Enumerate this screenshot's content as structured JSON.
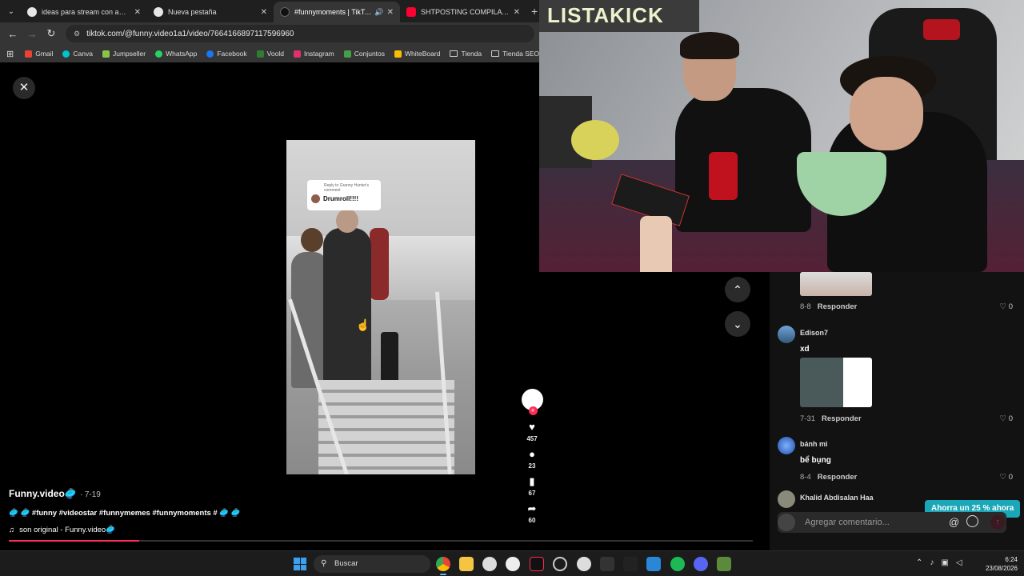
{
  "browser": {
    "tabs": [
      {
        "title": "ideas para stream con amigos",
        "fav_color": "#e6e6e6",
        "active": false
      },
      {
        "title": "Nueva pestaña",
        "fav_color": "#e6e6e6",
        "active": false
      },
      {
        "title": "#funnymoments | TikTok",
        "fav_color": "#111111",
        "active": true
      },
      {
        "title": "SHTPOSTING COMPILATION V",
        "fav_color": "#ff0033",
        "active": false
      }
    ],
    "url": "tiktok.com/@funny.video1a1/video/7664166897117596960",
    "bookmarks": [
      {
        "label": "Gmail",
        "color": "#ea4335"
      },
      {
        "label": "Canva",
        "color": "#00c4cc"
      },
      {
        "label": "Jumpseller",
        "color": "#8bc34a"
      },
      {
        "label": "WhatsApp",
        "color": "#25d366"
      },
      {
        "label": "Facebook",
        "color": "#1877f2"
      },
      {
        "label": "Voold",
        "color": "#2e7d32"
      },
      {
        "label": "Instagram",
        "color": "#e1306c"
      },
      {
        "label": "Conjuntos",
        "color": "#43a047"
      },
      {
        "label": "WhiteBoard",
        "color": "#fbbc05"
      },
      {
        "label": "Tienda",
        "folder": true
      },
      {
        "label": "Tienda SEO",
        "folder": true
      }
    ]
  },
  "video": {
    "reply_card_small": "Reply to Granny Hunter's comment",
    "reply_card_text": "Drumroll!!!!",
    "progress": 0.175
  },
  "caption": {
    "author": "Funny.video🥏",
    "date": "· 7-19",
    "description": "🥏 🥏 #funny #videostar #funnymemes #funnymoments # 🥏 🥏",
    "sound": "son original - Funny.video🥏"
  },
  "actions": {
    "likes": "457",
    "comments": "23",
    "saves": "67",
    "shares": "60"
  },
  "comments": [
    {
      "name": "",
      "text": "",
      "date": "8-8",
      "reply": "Responder",
      "likes": "0"
    },
    {
      "name": "Edison7",
      "text": "xd",
      "date": "7-31",
      "reply": "Responder",
      "likes": "0"
    },
    {
      "name": "bánh mì",
      "text": "bể bụng",
      "date": "8-4",
      "reply": "Responder",
      "likes": "0"
    },
    {
      "name": "Khalid Abdisalan Haa",
      "text": "",
      "date": "",
      "reply": "",
      "likes": ""
    }
  ],
  "comment_input_placeholder": "Agregar comentario...",
  "promo": "Ahorra un 25 % ahora",
  "stream_overlay_text": "LISTAKICK",
  "taskbar": {
    "search_label": "Buscar",
    "time": "6:24",
    "date": "23/08/2026"
  }
}
